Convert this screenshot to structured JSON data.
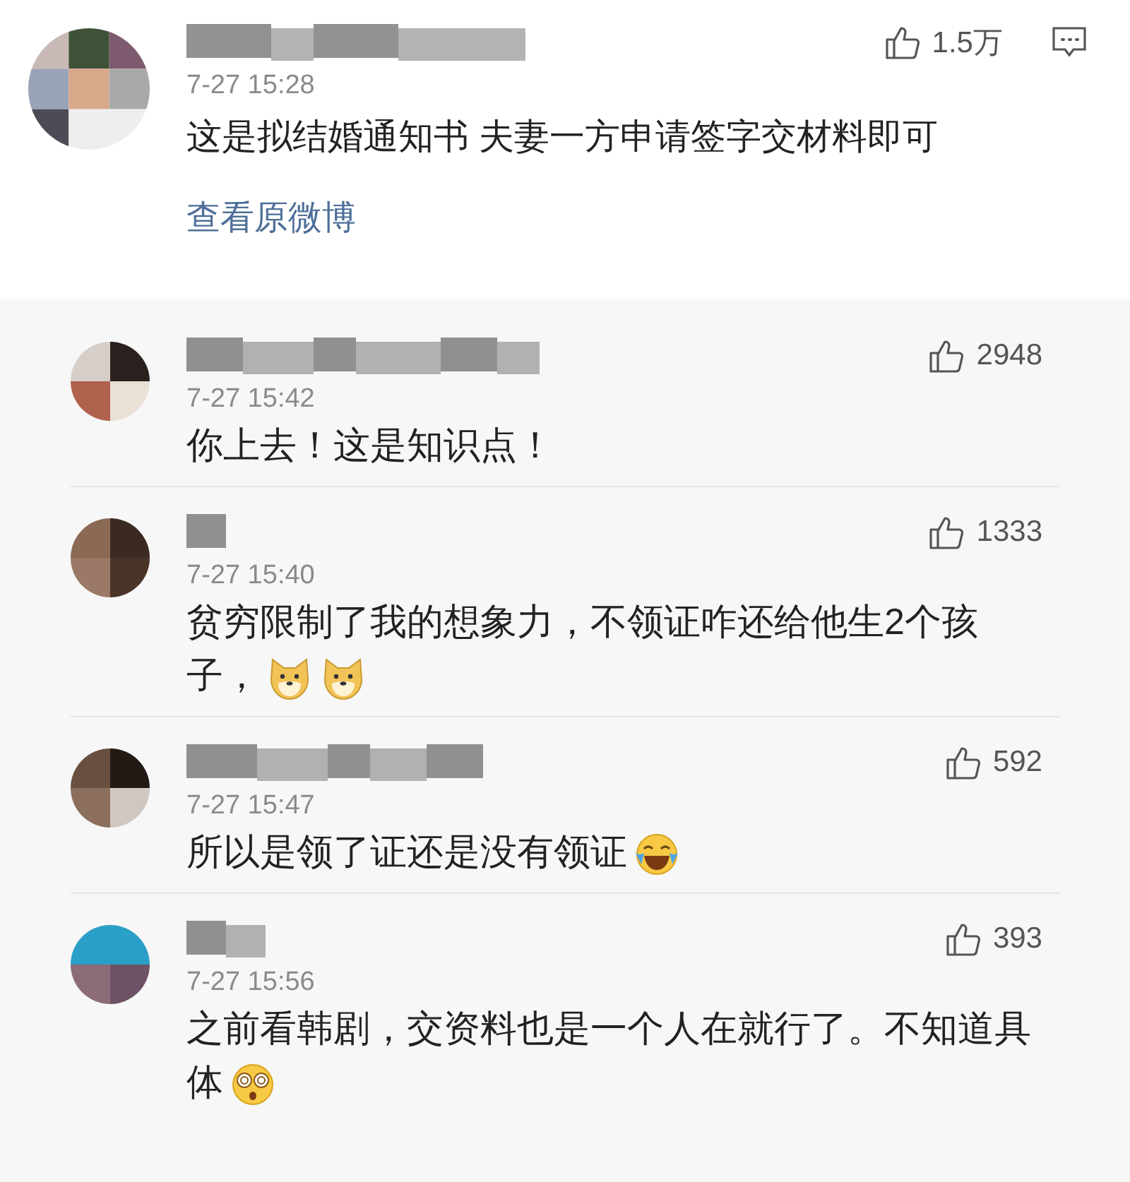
{
  "post": {
    "time": "7-27 15:28",
    "likes": "1.5万",
    "text": "这是拟结婚通知书 夫妻一方申请签字交材料即可",
    "link": "查看原微博"
  },
  "replies": [
    {
      "time": "7-27 15:42",
      "likes": "2948",
      "text": "你上去！这是知识点！"
    },
    {
      "time": "7-27 15:40",
      "likes": "1333",
      "text": "贫穷限制了我的想象力，不领证咋还给他生2个孩子，",
      "emojis": [
        {
          "kind": "doge"
        },
        {
          "kind": "doge"
        }
      ]
    },
    {
      "time": "7-27 15:47",
      "likes": "592",
      "text": "所以是领了证还是没有领证",
      "emojis": [
        {
          "kind": "laugh-cry"
        }
      ]
    },
    {
      "time": "7-27 15:56",
      "likes": "393",
      "text": "之前看韩剧，交资料也是一个人在就行了。不知道具体",
      "emojis": [
        {
          "kind": "dizzy"
        }
      ]
    }
  ]
}
